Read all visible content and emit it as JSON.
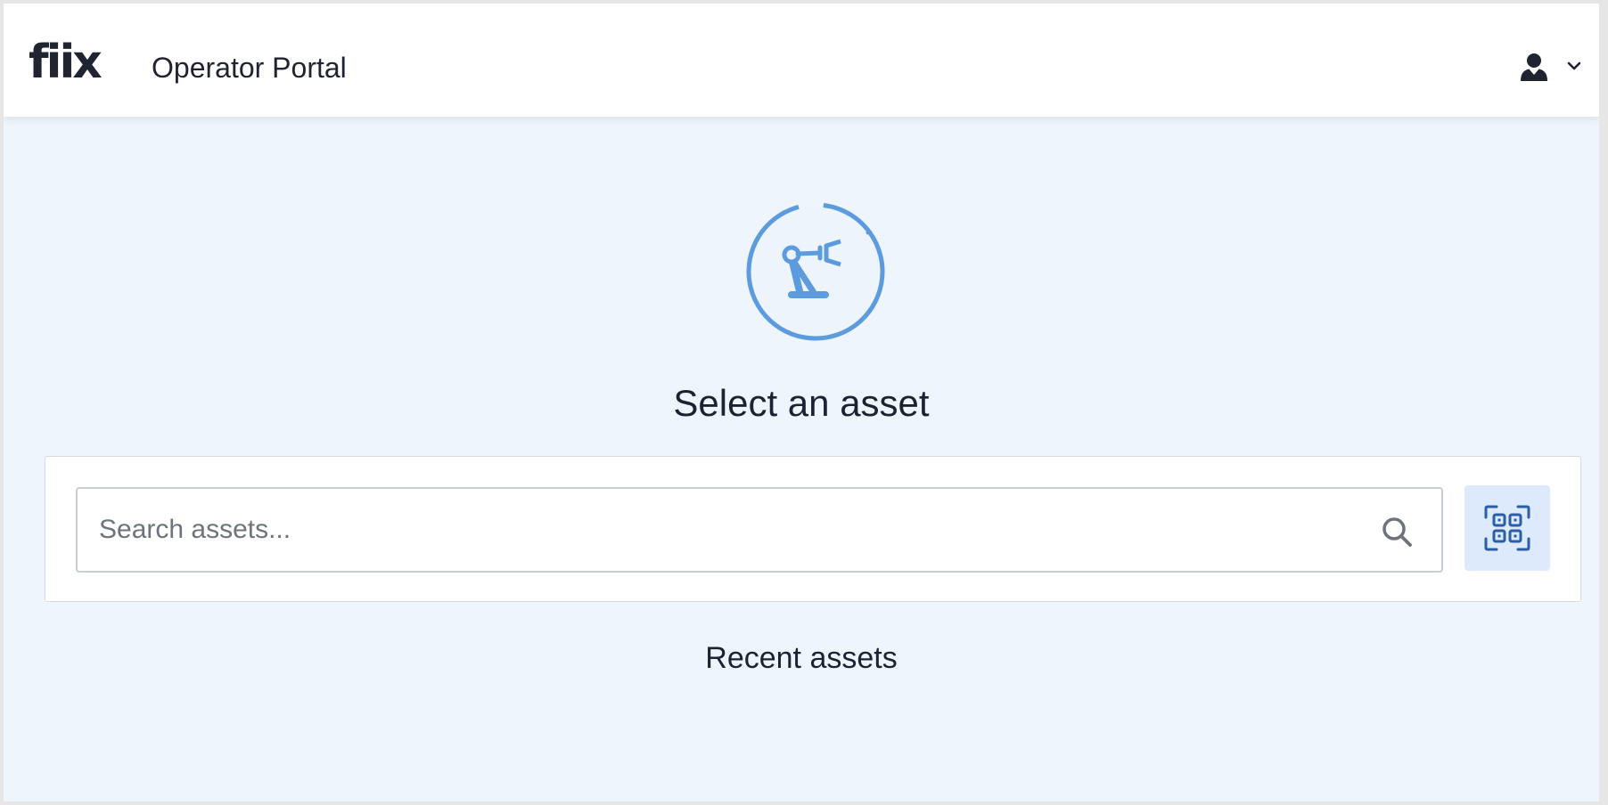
{
  "header": {
    "logo_text": "fiix",
    "app_title": "Operator Portal",
    "user_menu_icon": "user-icon",
    "dropdown_icon": "chevron-down-icon"
  },
  "main": {
    "hero_icon": "robot-arm-icon",
    "heading": "Select an asset",
    "search": {
      "placeholder": "Search assets...",
      "value": "",
      "search_icon": "search-icon",
      "scan_button_icon": "qr-code-scan-icon"
    },
    "recent_heading": "Recent assets"
  },
  "colors": {
    "background": "#eff5fd",
    "accent": "#5b9bde",
    "scan_button_bg": "#dceafc",
    "scan_icon": "#2a5ea6",
    "text": "#1c2231"
  }
}
